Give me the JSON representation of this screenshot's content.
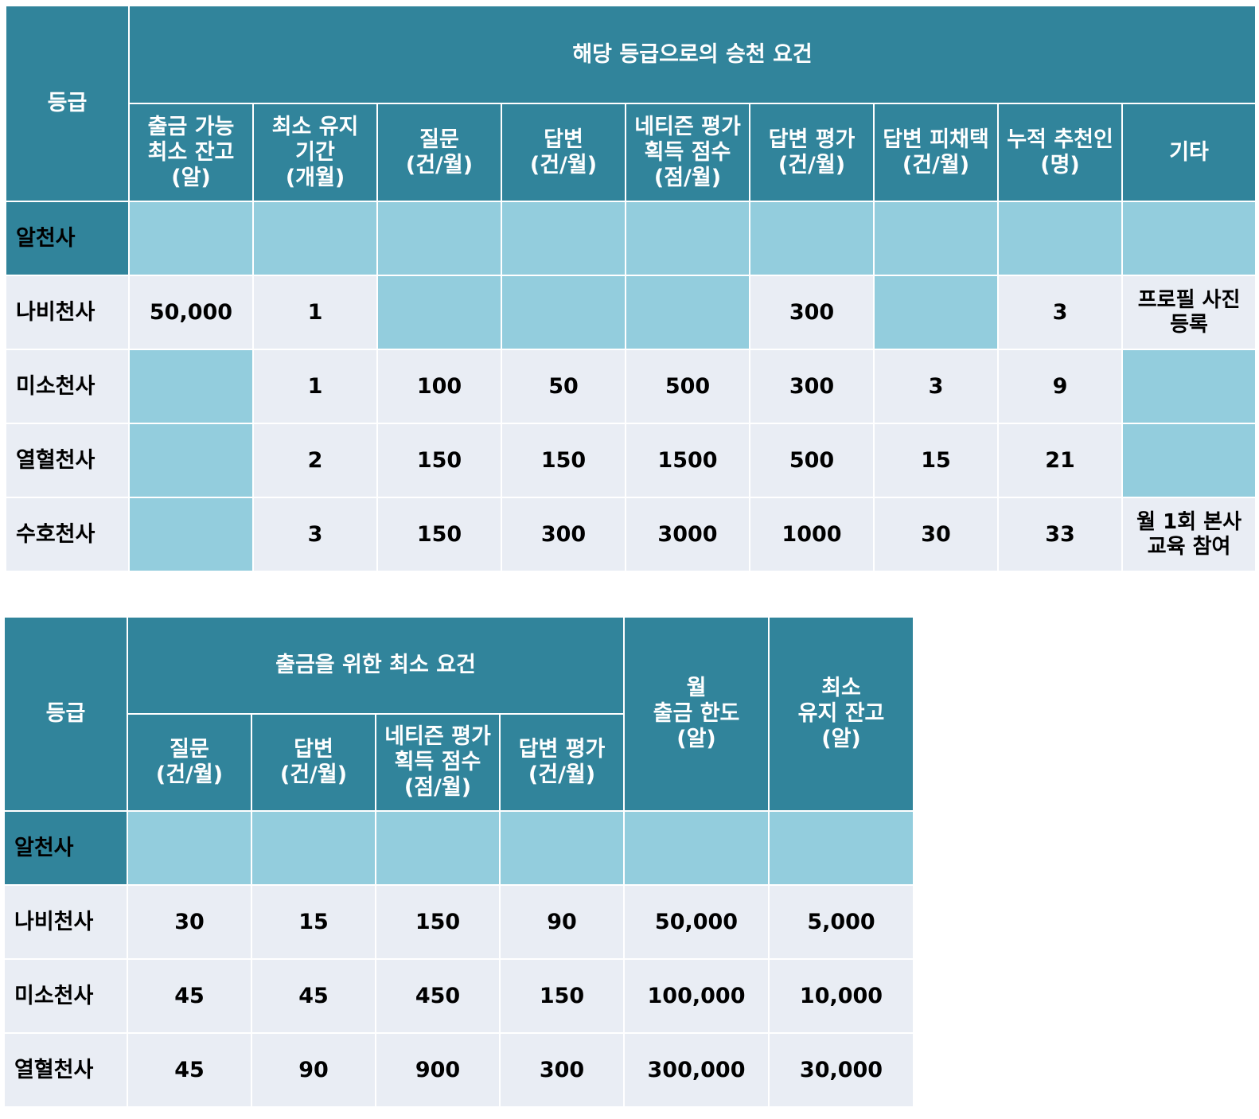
{
  "table1": {
    "grade_header": "등급",
    "group_header": "해당 등급으로의 승천 요건",
    "columns": [
      [
        "출금 가능",
        "최소 잔고",
        "(알)"
      ],
      [
        "최소 유지",
        "기간",
        "(개월)"
      ],
      [
        "질문",
        "(건/월)"
      ],
      [
        "답변",
        "(건/월)"
      ],
      [
        "네티즌 평가",
        "획득 점수",
        "(점/월)"
      ],
      [
        "답변 평가",
        "(건/월)"
      ],
      [
        "답변 피채택",
        "(건/월)"
      ],
      [
        "누적 추천인",
        "(명)"
      ],
      [
        "기타"
      ]
    ],
    "rows": [
      {
        "grade": "알천사",
        "cells": [
          "",
          "",
          "",
          "",
          "",
          "",
          "",
          "",
          ""
        ]
      },
      {
        "grade": "나비천사",
        "cells": [
          "50,000",
          "1",
          "",
          "",
          "",
          "300",
          "",
          "3",
          "프로필 사진\n등록"
        ]
      },
      {
        "grade": "미소천사",
        "cells": [
          "",
          "1",
          "100",
          "50",
          "500",
          "300",
          "3",
          "9",
          ""
        ]
      },
      {
        "grade": "열혈천사",
        "cells": [
          "",
          "2",
          "150",
          "150",
          "1500",
          "500",
          "15",
          "21",
          ""
        ]
      },
      {
        "grade": "수호천사",
        "cells": [
          "",
          "3",
          "150",
          "300",
          "3000",
          "1000",
          "30",
          "33",
          "월 1회 본사\n교육 참여"
        ]
      }
    ]
  },
  "table2": {
    "grade_header": "등급",
    "group_header": "출금을 위한 최소 요건",
    "group_columns": [
      [
        "질문",
        "(건/월)"
      ],
      [
        "답변",
        "(건/월)"
      ],
      [
        "네티즌 평가",
        "획득 점수",
        "(점/월)"
      ],
      [
        "답변 평가",
        "(건/월)"
      ]
    ],
    "extra_columns": [
      [
        "월",
        "출금 한도",
        "(알)"
      ],
      [
        "최소",
        "유지 잔고",
        "(알)"
      ]
    ],
    "rows": [
      {
        "grade": "알천사",
        "cells": [
          "",
          "",
          "",
          "",
          "",
          ""
        ]
      },
      {
        "grade": "나비천사",
        "cells": [
          "30",
          "15",
          "150",
          "90",
          "50,000",
          "5,000"
        ]
      },
      {
        "grade": "미소천사",
        "cells": [
          "45",
          "45",
          "450",
          "150",
          "100,000",
          "10,000"
        ]
      },
      {
        "grade": "열혈천사",
        "cells": [
          "45",
          "90",
          "900",
          "300",
          "300,000",
          "30,000"
        ]
      }
    ]
  },
  "colors": {
    "header": "#31849b",
    "empty_cell": "#93cddd",
    "data_cell": "#e9edf4"
  }
}
